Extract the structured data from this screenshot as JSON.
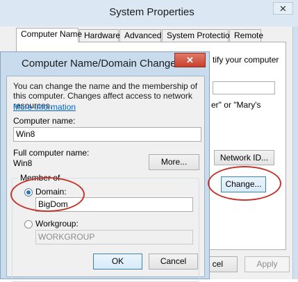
{
  "system_properties": {
    "title": "System Properties",
    "close_glyph": "✕",
    "tabs": [
      {
        "label": "Computer Name",
        "active": true
      },
      {
        "label": "Hardware",
        "active": false
      },
      {
        "label": "Advanced",
        "active": false
      },
      {
        "label": "System Protection",
        "active": false
      },
      {
        "label": "Remote",
        "active": false
      }
    ],
    "partial_text_1": "tify your computer",
    "partial_text_2": "er\" or \"Mary's",
    "network_id_button": "Network ID...",
    "change_button": "Change...",
    "cancel_button_partial": "cel",
    "apply_button": "Apply"
  },
  "dialog": {
    "title": "Computer Name/Domain Changes",
    "close_glyph": "✕",
    "description": "You can change the name and the membership of this computer. Changes affect access to network resources.",
    "more_info_link": "More information",
    "computer_name_label": "Computer name:",
    "computer_name_value": "Win8",
    "full_name_label": "Full computer name:",
    "full_name_value": "Win8",
    "more_button": "More...",
    "member_of_label": "Member of",
    "domain_label": "Domain:",
    "domain_value": "BigDom",
    "domain_selected": true,
    "workgroup_label": "Workgroup:",
    "workgroup_value": "WORKGROUP",
    "ok_button": "OK",
    "cancel_button": "Cancel"
  },
  "colors": {
    "highlight_ellipse": "#c3362b",
    "close_button_red": "#c9402d",
    "link_blue": "#0066cc"
  }
}
